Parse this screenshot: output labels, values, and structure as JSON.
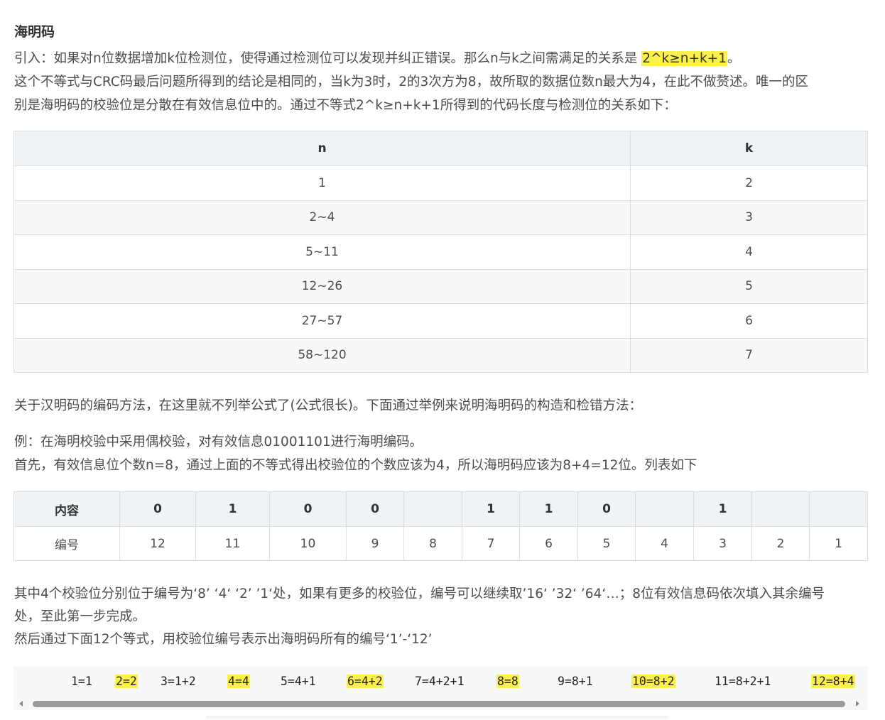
{
  "heading": "海明码",
  "intro": {
    "prefix": "引入：如果对n位数据增加k位检测位，使得通过检测位可以发现并纠正错误。那么n与k之间需满足的关系是",
    "highlight": "2^k≥n+k+1",
    "suffix": "。"
  },
  "paragraph2_line1": "这个不等式与CRC码最后问题所得到的结论是相同的，当k为3时，2的3次方为8，故所取的数据位数n最大为4，在此不做赘述。唯一的区",
  "paragraph2_line2": "别是海明码的校验位是分散在有效信息位中的。通过不等式2^k≥n+k+1所得到的代码长度与检测位的关系如下：",
  "nk_table": {
    "headers": [
      "n",
      "k"
    ],
    "rows": [
      [
        "1",
        "2"
      ],
      [
        "2~4",
        "3"
      ],
      [
        "5~11",
        "4"
      ],
      [
        "12~26",
        "5"
      ],
      [
        "27~57",
        "6"
      ],
      [
        "58~120",
        "7"
      ]
    ]
  },
  "paragraph3": "关于汉明码的编码方法，在这里就不列举公式了(公式很长)。下面通过举例来说明海明码的构造和检错方法：",
  "example_line1": "例：在海明校验中采用偶校验，对有效信息01001101进行海明编码。",
  "example_line2": "首先，有效信息位个数n=8，通过上面的不等式得出校验位的个数应该为4，所以海明码应该为8+4=12位。列表如下",
  "hamming_table": {
    "header_label": "内容",
    "contents": [
      "0",
      "1",
      "0",
      "0",
      "",
      "1",
      "1",
      "0",
      "",
      "1",
      "",
      ""
    ],
    "row_label": "编号",
    "numbers": [
      "12",
      "11",
      "10",
      "9",
      "8",
      "7",
      "6",
      "5",
      "4",
      "3",
      "2",
      "1"
    ]
  },
  "paragraph4_line1": "其中4个校验位分别位于编号为‘8’ ‘4‘ ‘2’ ’1‘处，如果有更多的校验位，编号可以继续取’16‘ ’32‘ ’64‘…；8位有效信息码依次填入其余编号",
  "paragraph4_line2": "处，至此第一步完成。",
  "paragraph5": "然后通过下面12个等式，用校验位编号表示出海明码所有的编号‘1’-‘12’",
  "equations": [
    {
      "text": "1=1",
      "highlight": false
    },
    {
      "text": "2=2",
      "highlight": true
    },
    {
      "text": "3=1+2",
      "highlight": false
    },
    {
      "text": "4=4",
      "highlight": true
    },
    {
      "text": "5=4+1",
      "highlight": false
    },
    {
      "text": "6=4+2",
      "highlight": true
    },
    {
      "text": "7=4+2+1",
      "highlight": false
    },
    {
      "text": "8=8",
      "highlight": true
    },
    {
      "text": "9=8+1",
      "highlight": false
    },
    {
      "text": "10=8+2",
      "highlight": true
    },
    {
      "text": "11=8+2+1",
      "highlight": false
    },
    {
      "text": "12=8+4",
      "highlight": true
    }
  ],
  "colors": {
    "highlight": "#fdf04a",
    "table_header_bg": "#eff3f5",
    "table_border": "#dddddd",
    "code_bg": "#f6f8fa"
  }
}
